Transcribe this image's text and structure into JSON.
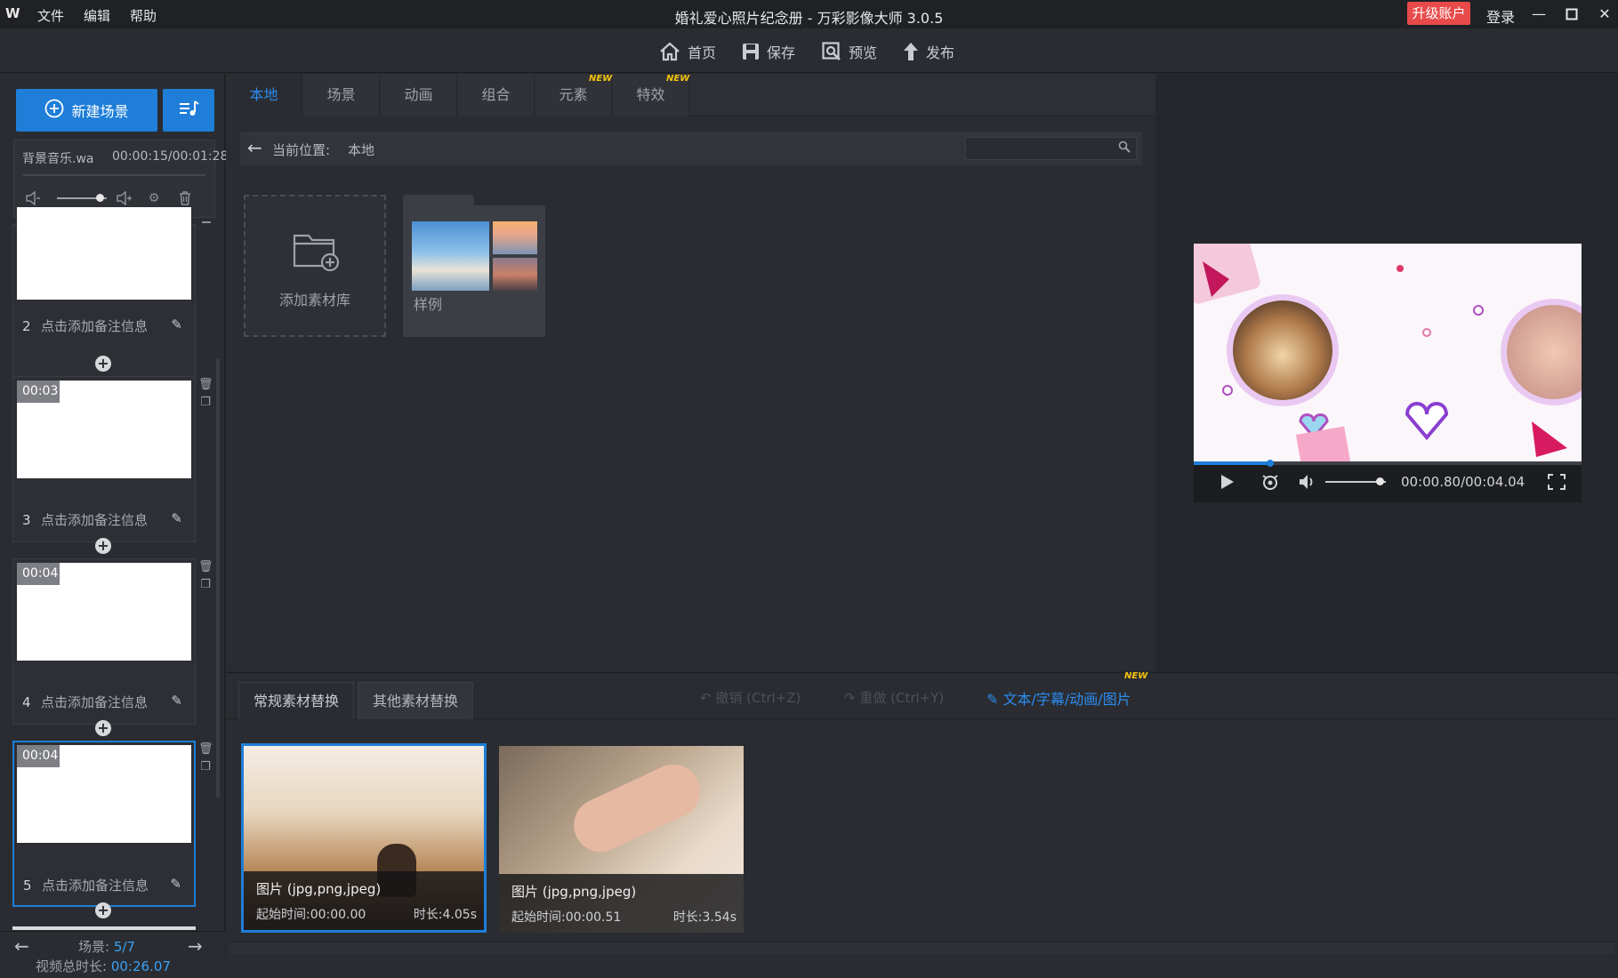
{
  "app": {
    "logo": "W",
    "title": "婚礼爱心照片纪念册 - 万彩影像大师 3.0.5",
    "menu": [
      "文件",
      "编辑",
      "帮助"
    ],
    "upgrade_label": "升级账户",
    "login_label": "登录",
    "window_controls": [
      "minimize-icon",
      "maximize-icon",
      "close-icon"
    ]
  },
  "toolbar": {
    "home_label": "首页",
    "save_label": "保存",
    "preview_label": "预览",
    "publish_label": "发布"
  },
  "left": {
    "new_scene_label": "新建场景",
    "music": {
      "name": "背景音乐.wa",
      "time": "00:00:15/00:01:28",
      "volume": 0.85
    },
    "scenes": [
      {
        "num": "2",
        "note": "点击添加备注信息",
        "duration": ""
      },
      {
        "num": "3",
        "note": "点击添加备注信息",
        "duration": "00:03"
      },
      {
        "num": "4",
        "note": "点击添加备注信息",
        "duration": "00:04"
      },
      {
        "num": "5",
        "note": "点击添加备注信息",
        "duration": "00:04"
      }
    ],
    "footer": {
      "scene_label": "场景: ",
      "scene_current": "5/7",
      "total_label": "视频总时长: ",
      "total_value": "00:26.07"
    }
  },
  "middle": {
    "tabs": [
      "本地",
      "场景",
      "动画",
      "组合",
      "元素",
      "特效"
    ],
    "active_tab": "本地",
    "new_badge": "NEW",
    "breadcrumb_label": "当前位置:",
    "breadcrumb_value": "本地",
    "search_placeholder": "",
    "add_library_label": "添加素材库",
    "sample_folder_label": "样例"
  },
  "preview": {
    "time": "00:00.80/00:04.04",
    "progress": 0.198,
    "volume": 0.9
  },
  "bottom": {
    "tabs": [
      "常规素材替换",
      "其他素材替换"
    ],
    "undo_label": "撤销 (Ctrl+Z)",
    "redo_label": "重做 (Ctrl+Y)",
    "text_edit_label": "文本/字幕/动画/图片",
    "new_badge": "NEW",
    "media": [
      {
        "type": "图片 (jpg,png,jpeg)",
        "start": "起始时间:00:00.00",
        "duration": "时长:4.05s"
      },
      {
        "type": "图片 (jpg,png,jpeg)",
        "start": "起始时间:00:00.51",
        "duration": "时长:3.54s"
      }
    ]
  },
  "colors": {
    "accent": "#1e7ed8",
    "upgrade": "#e84a4a",
    "badge": "#f4c20d"
  }
}
